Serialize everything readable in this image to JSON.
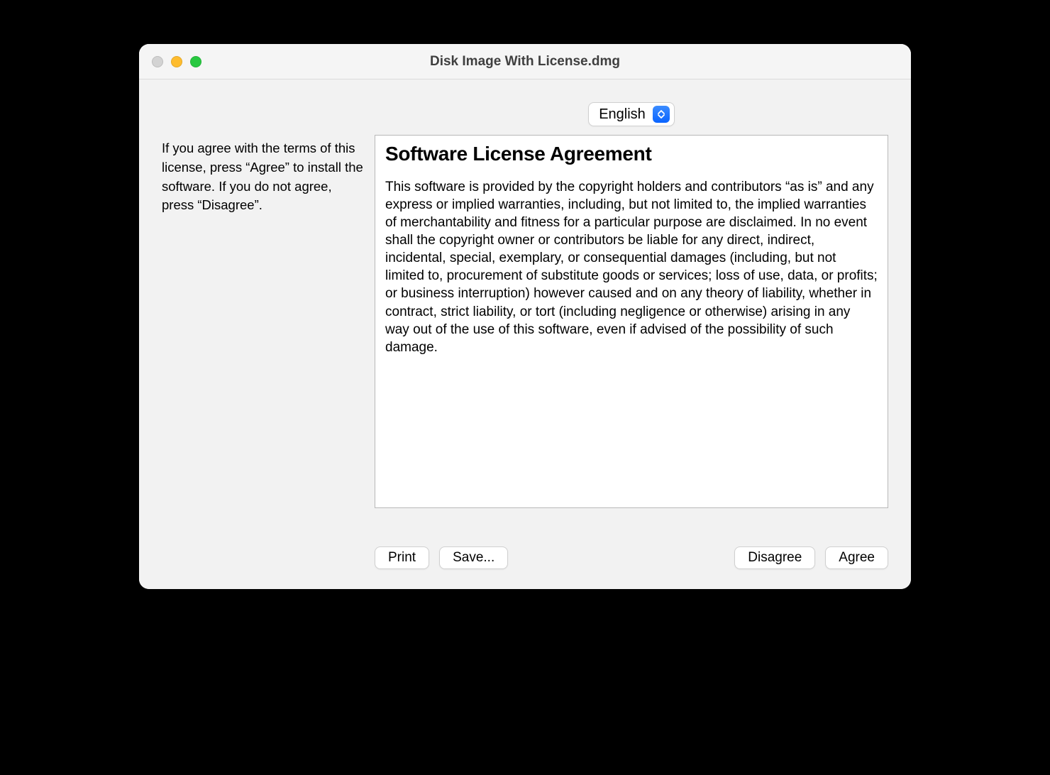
{
  "window": {
    "title": "Disk Image With License.dmg"
  },
  "language": {
    "selected": "English"
  },
  "sidebar": {
    "instructions": "If you agree with the terms of this license, press “Agree” to install the software. If you do not agree, press “Disagree”."
  },
  "license": {
    "heading": "Software License Agreement",
    "body": "This software is provided by the copyright holders and contributors “as is” and any express or implied warranties, including, but not limited to, the implied warranties of merchantability and fitness for a particular purpose are disclaimed. In no event shall the copyright owner or contributors be liable for any direct, indirect, incidental, special, exemplary, or consequential damages (including, but not limited to, procurement of substitute goods or services; loss of use, data, or profits; or business interruption) however caused and on any theory of liability, whether in contract, strict liability, or tort (including negligence or otherwise) arising in any way out of the use of this software, even if advised of the possibility of such damage."
  },
  "buttons": {
    "print": "Print",
    "save": "Save...",
    "disagree": "Disagree",
    "agree": "Agree"
  }
}
